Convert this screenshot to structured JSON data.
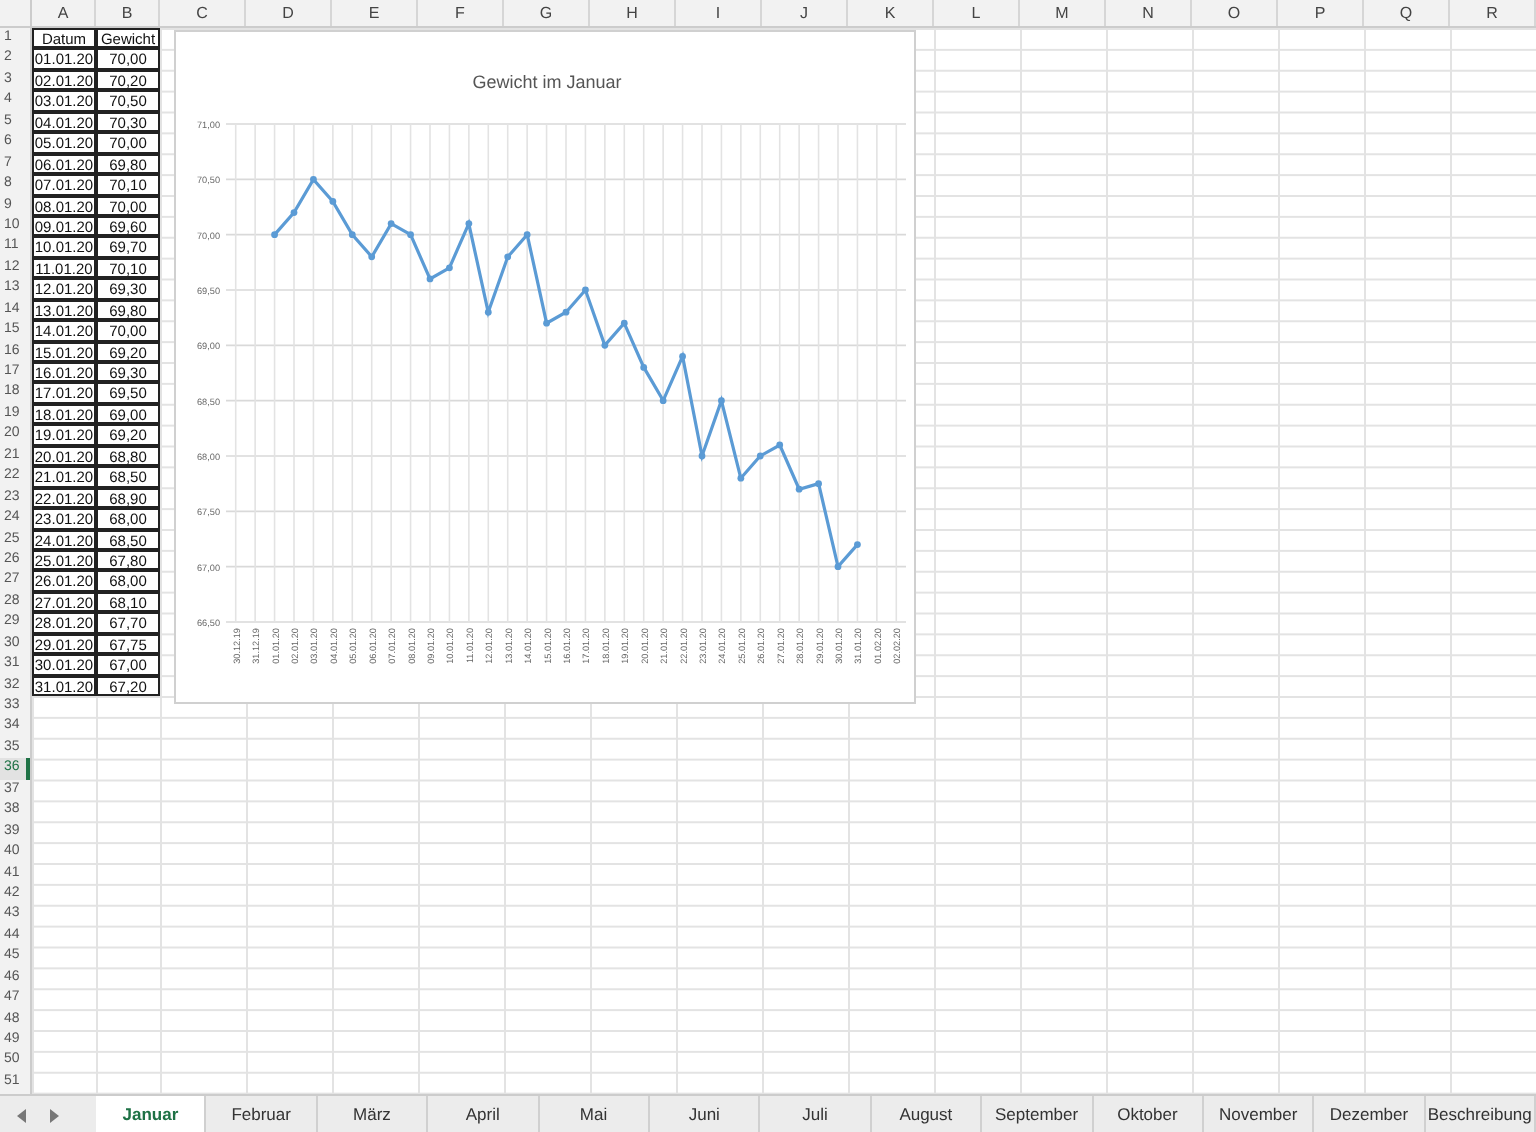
{
  "column_headers": [
    "A",
    "B",
    "C",
    "D",
    "E",
    "F",
    "G",
    "H",
    "I",
    "J",
    "K",
    "L",
    "M",
    "N",
    "O",
    "P",
    "Q",
    "R"
  ],
  "row_headers": [
    {
      "label": "1",
      "selected": false
    },
    {
      "label": "2",
      "selected": false
    },
    {
      "label": "3",
      "selected": false
    },
    {
      "label": "4",
      "selected": false
    },
    {
      "label": "5",
      "selected": false
    },
    {
      "label": "6",
      "selected": false
    },
    {
      "label": "7",
      "selected": false
    },
    {
      "label": "8",
      "selected": false
    },
    {
      "label": "9",
      "selected": false
    },
    {
      "label": "10",
      "selected": false
    },
    {
      "label": "11",
      "selected": false
    },
    {
      "label": "12",
      "selected": false
    },
    {
      "label": "13",
      "selected": false
    },
    {
      "label": "14",
      "selected": false
    },
    {
      "label": "15",
      "selected": false
    },
    {
      "label": "16",
      "selected": false
    },
    {
      "label": "17",
      "selected": false
    },
    {
      "label": "18",
      "selected": false
    },
    {
      "label": "19",
      "selected": false
    },
    {
      "label": "20",
      "selected": false
    },
    {
      "label": "21",
      "selected": false
    },
    {
      "label": "22",
      "selected": false
    },
    {
      "label": "23",
      "selected": false
    },
    {
      "label": "24",
      "selected": false
    },
    {
      "label": "25",
      "selected": false
    },
    {
      "label": "26",
      "selected": false
    },
    {
      "label": "27",
      "selected": false
    },
    {
      "label": "28",
      "selected": false
    },
    {
      "label": "29",
      "selected": false
    },
    {
      "label": "30",
      "selected": false
    },
    {
      "label": "31",
      "selected": false
    },
    {
      "label": "32",
      "selected": false
    },
    {
      "label": "33",
      "selected": false
    },
    {
      "label": "34",
      "selected": false
    },
    {
      "label": "35",
      "selected": false
    },
    {
      "label": "36",
      "selected": true
    },
    {
      "label": "37",
      "selected": false
    },
    {
      "label": "38",
      "selected": false
    },
    {
      "label": "39",
      "selected": false
    },
    {
      "label": "40",
      "selected": false
    },
    {
      "label": "41",
      "selected": false
    },
    {
      "label": "42",
      "selected": false
    },
    {
      "label": "43",
      "selected": false
    },
    {
      "label": "44",
      "selected": false
    },
    {
      "label": "45",
      "selected": false
    },
    {
      "label": "46",
      "selected": false
    },
    {
      "label": "47",
      "selected": false
    },
    {
      "label": "48",
      "selected": false
    },
    {
      "label": "49",
      "selected": false
    },
    {
      "label": "50",
      "selected": false
    },
    {
      "label": "51",
      "selected": false
    }
  ],
  "table": {
    "columns": [
      "Datum",
      "Gewicht"
    ],
    "rows": [
      [
        "01.01.20",
        "70,00"
      ],
      [
        "02.01.20",
        "70,20"
      ],
      [
        "03.01.20",
        "70,50"
      ],
      [
        "04.01.20",
        "70,30"
      ],
      [
        "05.01.20",
        "70,00"
      ],
      [
        "06.01.20",
        "69,80"
      ],
      [
        "07.01.20",
        "70,10"
      ],
      [
        "08.01.20",
        "70,00"
      ],
      [
        "09.01.20",
        "69,60"
      ],
      [
        "10.01.20",
        "69,70"
      ],
      [
        "11.01.20",
        "70,10"
      ],
      [
        "12.01.20",
        "69,30"
      ],
      [
        "13.01.20",
        "69,80"
      ],
      [
        "14.01.20",
        "70,00"
      ],
      [
        "15.01.20",
        "69,20"
      ],
      [
        "16.01.20",
        "69,30"
      ],
      [
        "17.01.20",
        "69,50"
      ],
      [
        "18.01.20",
        "69,00"
      ],
      [
        "19.01.20",
        "69,20"
      ],
      [
        "20.01.20",
        "68,80"
      ],
      [
        "21.01.20",
        "68,50"
      ],
      [
        "22.01.20",
        "68,90"
      ],
      [
        "23.01.20",
        "68,00"
      ],
      [
        "24.01.20",
        "68,50"
      ],
      [
        "25.01.20",
        "67,80"
      ],
      [
        "26.01.20",
        "68,00"
      ],
      [
        "27.01.20",
        "68,10"
      ],
      [
        "28.01.20",
        "67,70"
      ],
      [
        "29.01.20",
        "67,75"
      ],
      [
        "30.01.20",
        "67,00"
      ],
      [
        "31.01.20",
        "67,20"
      ]
    ]
  },
  "chart_data": {
    "type": "line",
    "title": "Gewicht im Januar",
    "categories": [
      "30.12.19",
      "31.12.19",
      "01.01.20",
      "02.01.20",
      "03.01.20",
      "04.01.20",
      "05.01.20",
      "06.01.20",
      "07.01.20",
      "08.01.20",
      "09.01.20",
      "10.01.20",
      "11.01.20",
      "12.01.20",
      "13.01.20",
      "14.01.20",
      "15.01.20",
      "16.01.20",
      "17.01.20",
      "18.01.20",
      "19.01.20",
      "20.01.20",
      "21.01.20",
      "22.01.20",
      "23.01.20",
      "24.01.20",
      "25.01.20",
      "26.01.20",
      "27.01.20",
      "28.01.20",
      "29.01.20",
      "30.01.20",
      "31.01.20",
      "01.02.20",
      "02.02.20"
    ],
    "grid": true,
    "series": [
      {
        "color": "#5b9bd5",
        "marker": true,
        "values": [
          null,
          null,
          70.0,
          70.2,
          70.5,
          70.3,
          70.0,
          69.8,
          70.1,
          70.0,
          69.6,
          69.7,
          70.1,
          69.3,
          69.8,
          70.0,
          69.2,
          69.3,
          69.5,
          69.0,
          69.2,
          68.8,
          68.5,
          68.9,
          68.0,
          68.5,
          67.8,
          68.0,
          68.1,
          67.7,
          67.75,
          67.0,
          67.2,
          null,
          null
        ]
      }
    ],
    "ylim": [
      66.5,
      71
    ],
    "yticks": [
      {
        "value": 66.5,
        "label": "66,50"
      },
      {
        "value": 67,
        "label": "67,00"
      },
      {
        "value": 67.5,
        "label": "67,50"
      },
      {
        "value": 68,
        "label": "68,00"
      },
      {
        "value": 68.5,
        "label": "68,50"
      },
      {
        "value": 69,
        "label": "69,00"
      },
      {
        "value": 69.5,
        "label": "69,50"
      },
      {
        "value": 70,
        "label": "70,00"
      },
      {
        "value": 70.5,
        "label": "70,50"
      },
      {
        "value": 71,
        "label": "71,00"
      }
    ]
  },
  "tabs": [
    {
      "label": "Januar",
      "selected": true
    },
    {
      "label": "Februar",
      "selected": false
    },
    {
      "label": "März",
      "selected": false
    },
    {
      "label": "April",
      "selected": false
    },
    {
      "label": "Mai",
      "selected": false
    },
    {
      "label": "Juni",
      "selected": false
    },
    {
      "label": "Juli",
      "selected": false
    },
    {
      "label": "August",
      "selected": false
    },
    {
      "label": "September",
      "selected": false
    },
    {
      "label": "Oktober",
      "selected": false
    },
    {
      "label": "November",
      "selected": false
    },
    {
      "label": "Dezember",
      "selected": false
    },
    {
      "label": "Beschreibung",
      "selected": false
    }
  ]
}
